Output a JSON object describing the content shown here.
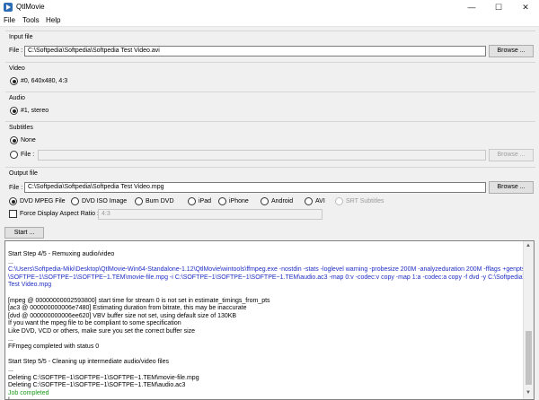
{
  "window": {
    "title": "QtlMovie",
    "min": "—",
    "max": "☐",
    "close": "✕"
  },
  "menu": [
    "File",
    "Tools",
    "Help"
  ],
  "input": {
    "title": "Input file",
    "file_label": "File :",
    "file_value": "C:\\Softpedia\\Softpedia\\Softpedia Test Video.avi",
    "browse": "Browse ..."
  },
  "video": {
    "title": "Video",
    "option": "#0, 640x480, 4:3"
  },
  "audio": {
    "title": "Audio",
    "option": "#1, stereo"
  },
  "subtitles": {
    "title": "Subtitles",
    "none": "None",
    "file": "File :",
    "browse": "Browse ..."
  },
  "output": {
    "title": "Output file",
    "file_label": "File :",
    "file_value": "C:\\Softpedia\\Softpedia\\Softpedia Test Video.mpg",
    "browse": "Browse ...",
    "formats": [
      "DVD MPEG File",
      "DVD ISO Image",
      "Burn DVD",
      "iPad",
      "iPhone",
      "Android",
      "AVI",
      "SRT Subtitles"
    ],
    "selected_format": "DVD MPEG File",
    "force_ratio": "Force Display Aspect Ratio :",
    "ratio_value": "4:3"
  },
  "start_button": "Start ...",
  "log": [
    {
      "text": "Start Step 4/5 - Remuxing audio/video",
      "color": "black"
    },
    {
      "text": "...",
      "color": "black"
    },
    {
      "text": "C:\\Users\\Softpedia-Miki\\Desktop\\QtlMovie-Win64-Standalone-1.12\\QtlMovie\\wintools\\ffmpeg.exe -nostdin -stats -loglevel warning -probesize 200M -analyzeduration 200M -fflags +genpts -i C:",
      "color": "blue"
    },
    {
      "text": "\\SOFTPE~1\\SOFTPE~1\\SOFTPE~1.TEM\\movie-file.mpg -i C:\\SOFTPE~1\\SOFTPE~1\\SOFTPE~1.TEM\\audio.ac3 -map 0:v -codec:v copy -map 1:a -codec:a copy -f dvd -y C:\\Softpedia\\Softpedia\\Softpedia",
      "color": "blue"
    },
    {
      "text": "Test Video.mpg",
      "color": "blue"
    },
    {
      "text": "",
      "color": "black"
    },
    {
      "text": "[mpeg @ 00000000002593800] start time for stream 0 is not set in estimate_timings_from_pts",
      "color": "black"
    },
    {
      "text": "[ac3 @ 000000000006e7480] Estimating duration from bitrate, this may be inaccurate",
      "color": "black"
    },
    {
      "text": "[dvd @ 000000000006ee620] VBV buffer size not set, using default size of 130KB",
      "color": "black"
    },
    {
      "text": "If you want the mpeg file to be compliant to some specification",
      "color": "black"
    },
    {
      "text": "Like DVD, VCD or others, make sure you set the correct buffer size",
      "color": "black"
    },
    {
      "text": "...",
      "color": "black"
    },
    {
      "text": "FFmpeg completed with status 0",
      "color": "black"
    },
    {
      "text": "",
      "color": "black"
    },
    {
      "text": "Start Step 5/5 - Cleaning up intermediate audio/video files",
      "color": "black"
    },
    {
      "text": "...",
      "color": "black"
    },
    {
      "text": "Deleting C:\\SOFTPE~1\\SOFTPE~1\\SOFTPE~1.TEM\\movie-file.mpg",
      "color": "black"
    },
    {
      "text": "Deleting C:\\SOFTPE~1\\SOFTPE~1\\SOFTPE~1.TEM\\audio.ac3",
      "color": "black"
    },
    {
      "text": "Job completed",
      "color": "green"
    }
  ]
}
